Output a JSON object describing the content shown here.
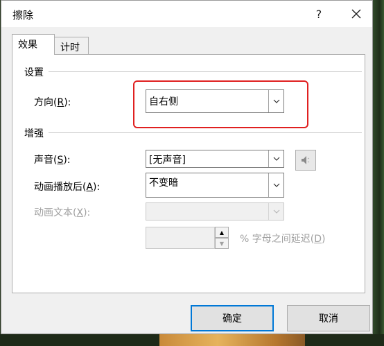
{
  "window": {
    "title": "擦除",
    "help_label": "?"
  },
  "tabs": [
    {
      "label": "效果",
      "active": true
    },
    {
      "label": "计时",
      "active": false
    }
  ],
  "settings_group": {
    "title": "设置",
    "direction": {
      "label": "方向(R):",
      "label_prefix": "方向(",
      "accel": "R",
      "label_suffix": "):",
      "value": "自右侧"
    }
  },
  "enhance_group": {
    "title": "增强",
    "sound": {
      "label_prefix": "声音(",
      "accel": "S",
      "label_suffix": "):",
      "value": "[无声音]"
    },
    "after_animation": {
      "label_prefix": "动画播放后(",
      "accel": "A",
      "label_suffix": "):",
      "value": "不变暗"
    },
    "animate_text": {
      "label_prefix": "动画文本(",
      "accel": "X",
      "label_suffix": "):",
      "value": "",
      "disabled": true
    },
    "letter_delay": {
      "value": "",
      "label_prefix": "% 字母之间延迟(",
      "accel": "D",
      "label_suffix": ")",
      "disabled": true
    }
  },
  "buttons": {
    "ok_label": "确定",
    "cancel_label": "取消"
  },
  "colors": {
    "highlight": "#e02020",
    "focus_border": "#0078d7"
  },
  "icons": {
    "close": "close-icon",
    "dropdown": "chevron-down-icon",
    "sound": "speaker-icon"
  }
}
